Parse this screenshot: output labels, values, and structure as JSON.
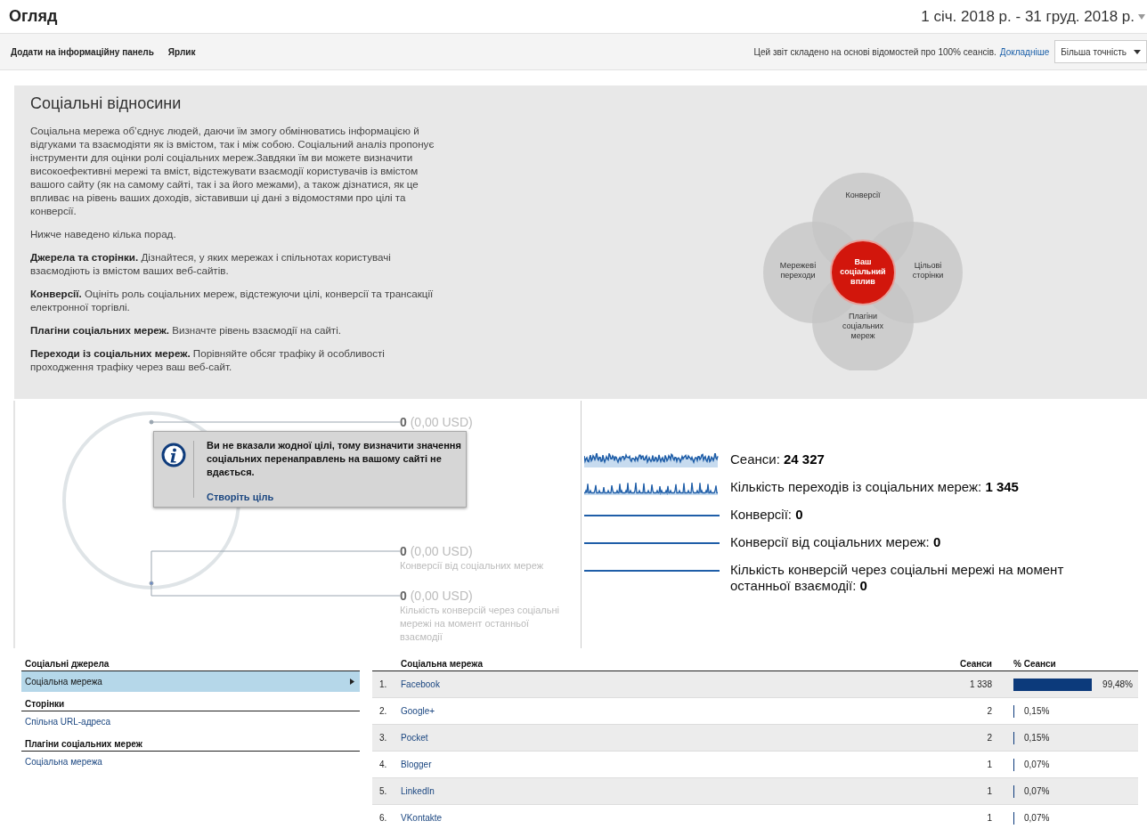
{
  "header": {
    "title": "Огляд",
    "date_range": "1 січ. 2018 р. - 31 груд. 2018 р."
  },
  "toolbar": {
    "actions": [
      "Додати на інформаційну панель",
      "Ярлик"
    ],
    "notice": "Цей звіт складено на основі відомостей про 100% сеансів.",
    "notice_link": "Докладніше",
    "precision_button": "Більша точність"
  },
  "intro": {
    "title": "Соціальні відносини",
    "paragraphs": [
      "Соціальна мережа об’єднує людей, даючи їм змогу обмінюватись інформацією й відгуками та взаємодіяти як із вмістом, так і між собою. Соціальний аналіз пропонує інструменти для оцінки ролі соціальних мереж.Завдяки їм ви можете визначити високоефективні мережі та вміст, відстежувати взаємодії користувачів із вмістом вашого сайту (як на самому сайті, так і за його межами), а також дізнатися, як це впливає на рівень ваших доходів, зіставивши ці дані з відомостями про цілі та конверсії.",
      "Нижче наведено кілька порад.",
      "**Джерела та сторінки.** Дізнайтеся, у яких мережах і спільнотах користувачі взаємодіють із вмістом ваших веб-сайтів.",
      "**Конверсії.** Оцініть роль соціальних мереж, відстежуючи цілі, конверсії та трансакції електронної торгівлі.",
      "**Плагіни соціальних мереж.** Визначте рівень взаємодії на сайті.",
      "**Переходи із соціальних мереж.** Порівняйте обсяг трафіку й особливості проходження трафіку через ваш веб-сайт."
    ],
    "diagram": {
      "top": "Конверсії",
      "left": "Мережеві переходи",
      "right": "Цільові сторінки",
      "bottom": "Плагіни соціальних мереж",
      "center": "Ваш соціальний вплив"
    }
  },
  "value_flow": {
    "values": [
      {
        "value": "0",
        "amount": "(0,00 USD)"
      },
      {
        "value": "0",
        "amount": "(0,00 USD)",
        "caption": "Конверсії від соціальних мереж"
      },
      {
        "value": "0",
        "amount": "(0,00 USD)",
        "caption": "Кількість конверсій через соціальні мережі на момент останньої взаємодії"
      }
    ],
    "notice": {
      "message": "Ви не вказали жодної цілі, тому визначити значення соціальних перенаправлень на вашому сайті не вдається.",
      "link": "Створіть ціль"
    }
  },
  "metrics": [
    {
      "kind": "dense",
      "label": "Сеанси:",
      "value": "24 327"
    },
    {
      "kind": "spiky",
      "label": "Кількість переходів із соціальних мереж:",
      "value": "1 345"
    },
    {
      "kind": "flat",
      "label": "Конверсії:",
      "value": "0"
    },
    {
      "kind": "flat",
      "label": "Конверсії від соціальних мереж:",
      "value": "0"
    },
    {
      "kind": "flat",
      "label": "Кількість конверсій через соціальні мережі на момент останньої взаємодії:",
      "value": "0"
    }
  ],
  "sources": [
    {
      "heading": "Соціальні джерела",
      "items": [
        {
          "label": "Соціальна мережа",
          "selected": true
        }
      ]
    },
    {
      "heading": "Сторінки",
      "items": [
        {
          "label": "Спільна URL-адреса",
          "selected": false
        }
      ]
    },
    {
      "heading": "Плагіни соціальних мереж",
      "items": [
        {
          "label": "Соціальна мережа",
          "selected": false
        }
      ]
    }
  ],
  "table": {
    "columns": [
      "Соціальна мережа",
      "Сеанси",
      "% Сеанси"
    ],
    "rows": [
      {
        "index": "1.",
        "network": "Facebook",
        "sessions": "1 338",
        "share": "99,48%"
      },
      {
        "index": "2.",
        "network": "Google+",
        "sessions": "2",
        "share": "0,15%"
      },
      {
        "index": "3.",
        "network": "Pocket",
        "sessions": "2",
        "share": "0,15%"
      },
      {
        "index": "4.",
        "network": "Blogger",
        "sessions": "1",
        "share": "0,07%"
      },
      {
        "index": "5.",
        "network": "LinkedIn",
        "sessions": "1",
        "share": "0,07%"
      },
      {
        "index": "6.",
        "network": "VKontakte",
        "sessions": "1",
        "share": "0,07%"
      }
    ]
  }
}
